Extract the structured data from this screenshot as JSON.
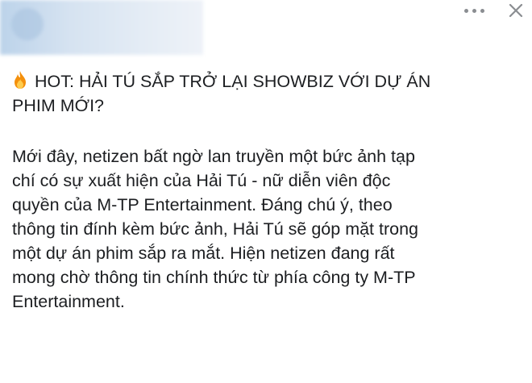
{
  "header": {
    "more_icon": "more-horizontal-icon",
    "close_icon": "close-icon"
  },
  "post": {
    "emoji_icon": "fire-emoji-icon",
    "headline": "HOT: HẢI TÚ SẮP TRỞ LẠI SHOWBIZ VỚI DỰ ÁN\nPHIM MỚI?",
    "body": "Mới đây, netizen bất ngờ lan truyền một bức ảnh tạp\nchí có sự xuất hiện của Hải Tú - nữ diễn viên độc\nquyền của M-TP Entertainment. Đáng chú ý, theo\nthông tin đính kèm bức ảnh, Hải Tú sẽ góp mặt trong\nmột dự án phim sắp ra mắt. Hiện netizen đang rất\nmong chờ thông tin chính thức từ phía công ty M-TP\nEntertainment."
  },
  "colors": {
    "text": "#1c1e21",
    "icon_gray": "#8a8d91",
    "background": "#ffffff"
  }
}
